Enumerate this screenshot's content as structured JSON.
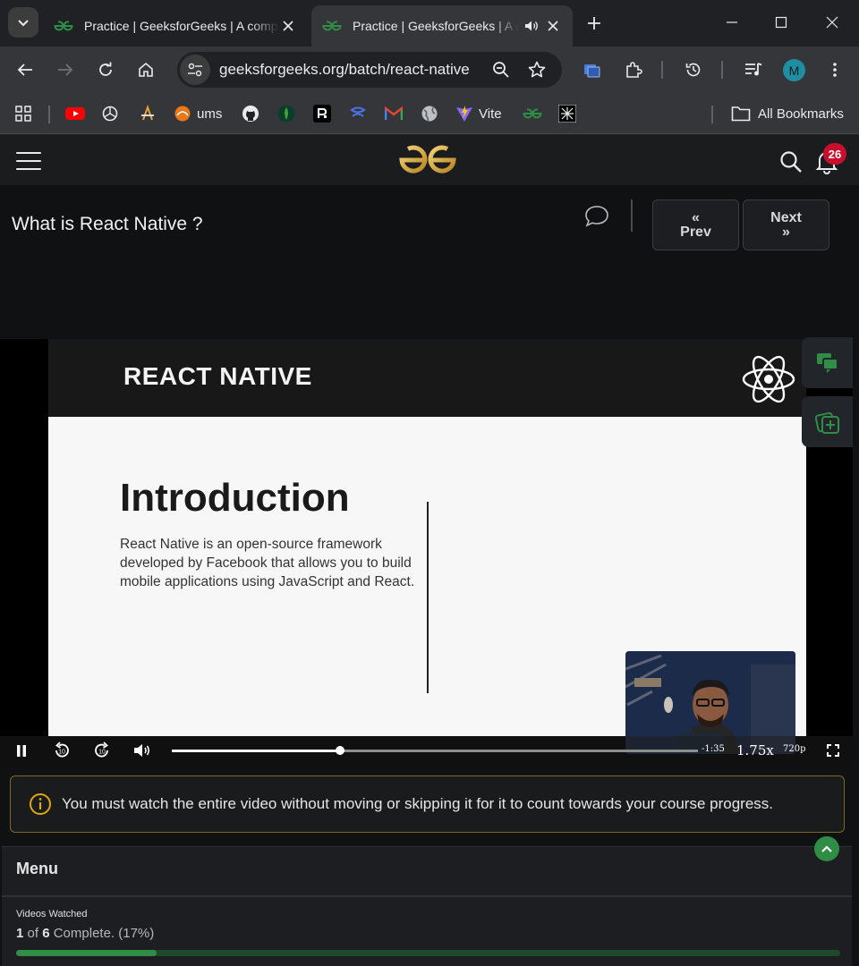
{
  "browser": {
    "tabs": [
      {
        "title": "Practice | GeeksforGeeks | A computer science portal for geeks",
        "active": false
      },
      {
        "title": "Practice | GeeksforGeeks | A computer science portal for geeks",
        "active": true,
        "playing_audio": true
      }
    ],
    "url": "geeksforgeeks.org/batch/react-native",
    "profile_initial": "M",
    "bookmarks": [
      {
        "icon": "apps-icon",
        "label": ""
      },
      {
        "icon": "youtube-icon",
        "label": ""
      },
      {
        "icon": "chatgpt-icon",
        "label": ""
      },
      {
        "icon": "codechef-icon",
        "label": ""
      },
      {
        "icon": "ums-icon",
        "label": "ums"
      },
      {
        "icon": "github-icon",
        "label": ""
      },
      {
        "icon": "mongodb-icon",
        "label": ""
      },
      {
        "icon": "replit-icon",
        "label": ""
      },
      {
        "icon": "doc-icon",
        "label": ""
      },
      {
        "icon": "gmail-icon",
        "label": ""
      },
      {
        "icon": "globe-icon",
        "label": ""
      },
      {
        "icon": "vite-icon",
        "label": "Vite"
      },
      {
        "icon": "gfg-icon",
        "label": ""
      },
      {
        "icon": "tool-icon",
        "label": ""
      }
    ],
    "all_bookmarks_label": "All Bookmarks"
  },
  "site": {
    "notification_count": "26",
    "accent": "#2f8d46"
  },
  "lesson": {
    "title": "What is React Native ?",
    "prev_label": "Prev",
    "next_label": "Next"
  },
  "video": {
    "slide": {
      "brand": "REACT NATIVE",
      "heading": "Introduction",
      "body": "React Native is an open-source framework developed by Facebook that allows you to build mobile applications using JavaScript and React."
    },
    "time_remaining": "-1:35",
    "speed": "1.75x",
    "quality": "720p",
    "progress_fraction": 0.319
  },
  "notice": {
    "text": "You must watch the entire video without moving or skipping it for it to count towards your course progress."
  },
  "menu": {
    "title": "Menu",
    "videos_watched_label": "Videos Watched",
    "watched": "1",
    "total": "6",
    "complete_text": "Complete. (17%)",
    "progress_fraction": 0.17
  }
}
